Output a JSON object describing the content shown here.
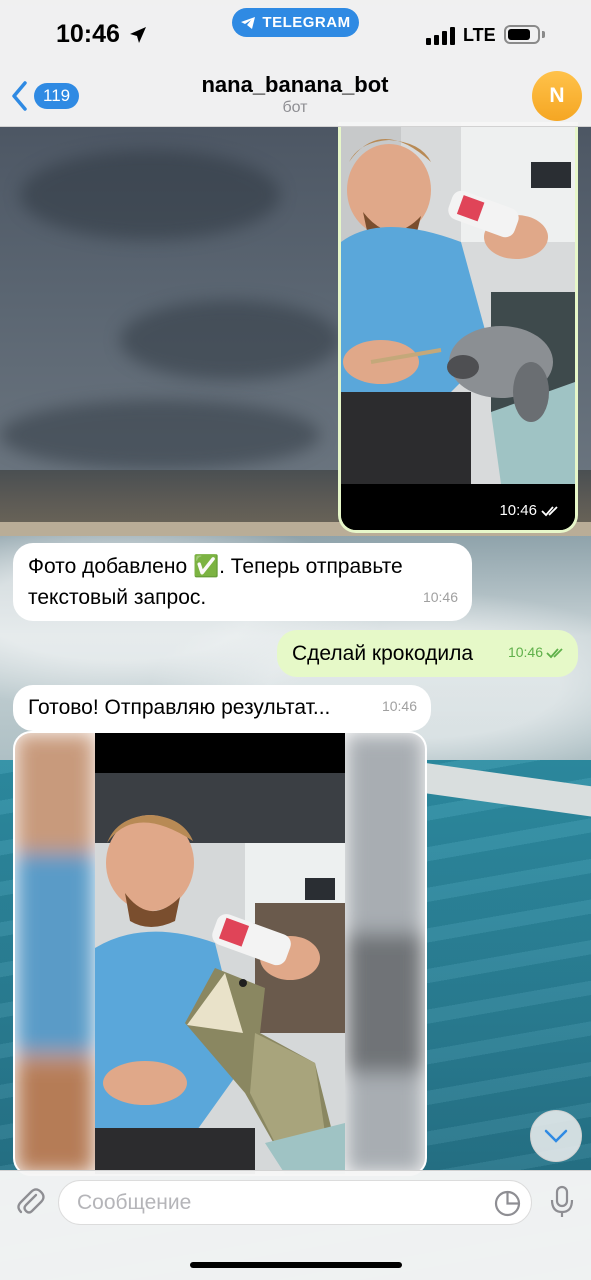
{
  "status_bar": {
    "time": "10:46",
    "app_pill": "TELEGRAM",
    "network": "LTE"
  },
  "header": {
    "back_count": "119",
    "title": "nana_banana_bot",
    "subtitle": "бот",
    "avatar_letter": "N",
    "avatar_color": "#f5a623"
  },
  "messages": [
    {
      "type": "photo",
      "direction": "outgoing",
      "time": "10:46",
      "status": "read"
    },
    {
      "type": "text",
      "direction": "incoming",
      "text": "Фото добавлено ✅. Теперь отправьте текстовый запрос.",
      "time": "10:46"
    },
    {
      "type": "text",
      "direction": "outgoing",
      "text": "Сделай крокодила",
      "time": "10:46",
      "status": "read"
    },
    {
      "type": "text",
      "direction": "incoming",
      "text": "Готово! Отправляю результат...",
      "time": "10:46"
    },
    {
      "type": "photo",
      "direction": "incoming"
    }
  ],
  "input": {
    "placeholder": "Сообщение"
  },
  "icons": {
    "back": "chevron-left-icon",
    "attach": "paperclip-icon",
    "sticker": "sticker-icon",
    "mic": "microphone-icon",
    "scroll": "chevron-down-icon",
    "read": "double-check-icon",
    "location": "location-arrow-icon"
  },
  "colors": {
    "accent": "#2f8ae3",
    "outgoing_bubble": "#e6f9c8",
    "incoming_bubble": "#ffffff"
  }
}
